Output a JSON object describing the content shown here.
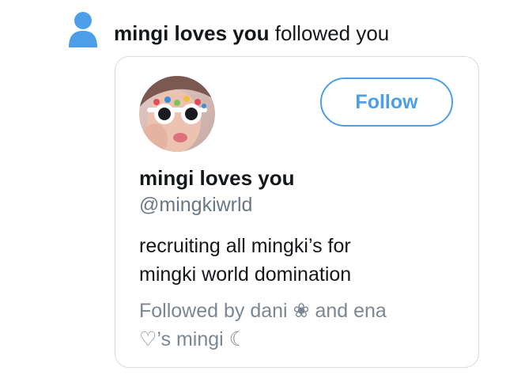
{
  "notification": {
    "name": "mingi loves you",
    "action": " followed you",
    "icon": "person-icon",
    "icon_color": "#4c9fe6"
  },
  "profile_card": {
    "follow_label": "Follow",
    "display_name": "mingi loves you",
    "handle": "@mingkiwrld",
    "bio_lines": [
      "recruiting all mingki’s for",
      "mingki world domination"
    ],
    "followed_by_lines": [
      "Followed by dani ❀ and ena",
      "♡’s mingi ☾"
    ],
    "accent_color": "#4c9fe6",
    "border_color": "#d3dce3"
  }
}
